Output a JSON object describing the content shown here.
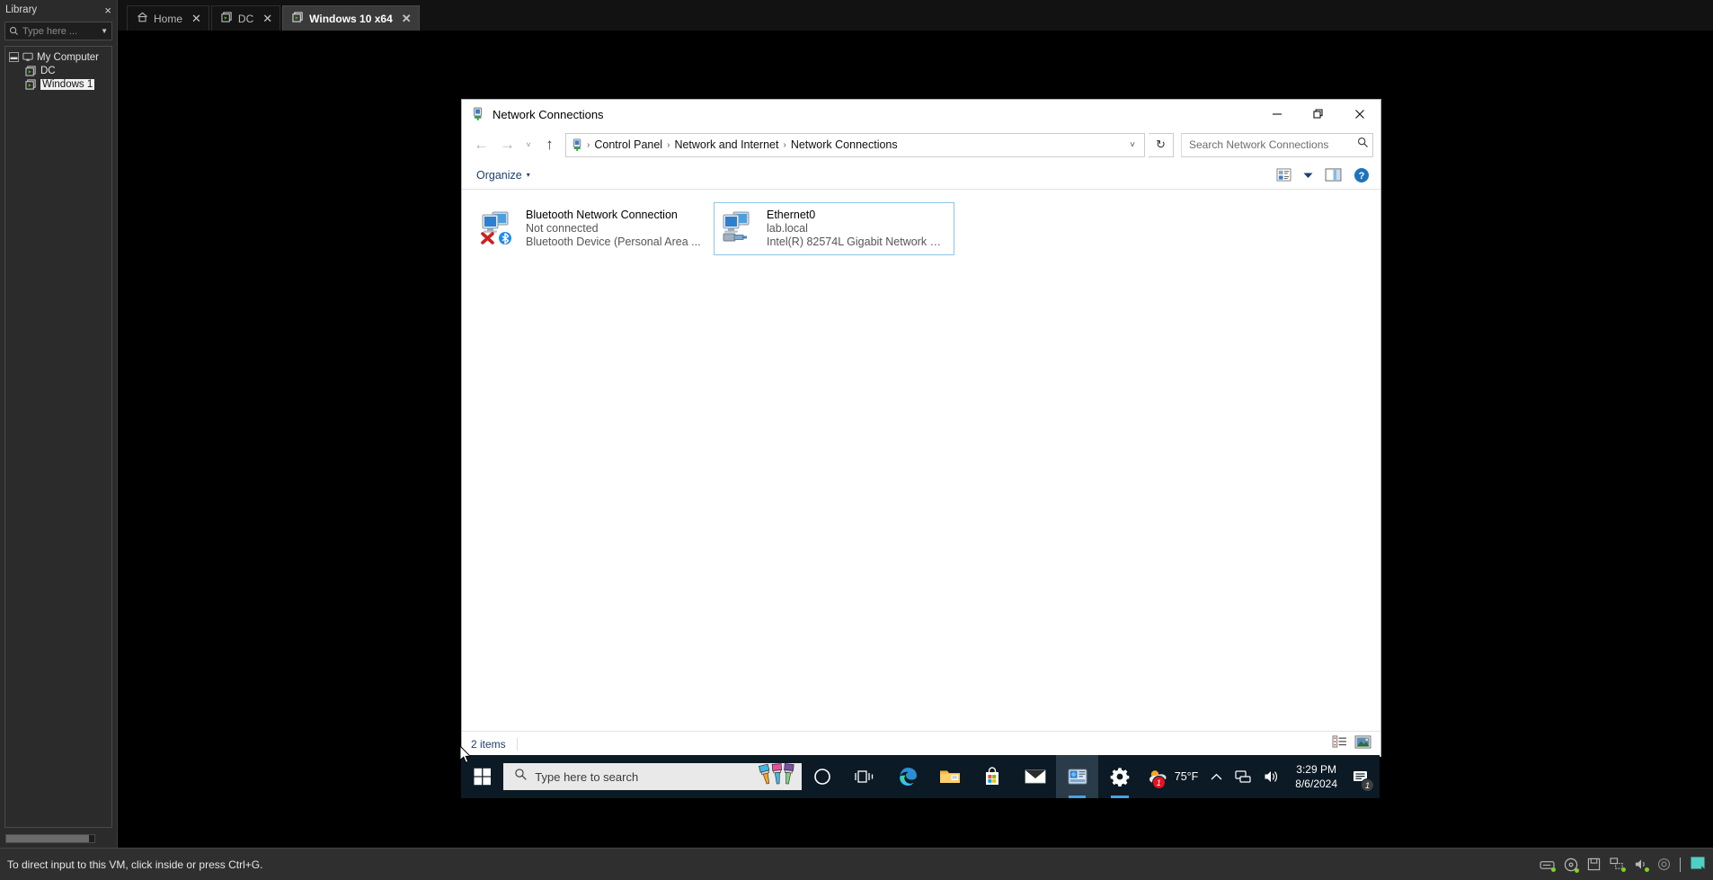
{
  "vmware": {
    "library": {
      "title": "Library",
      "close_label": "×",
      "search_placeholder": "Type here ...",
      "tree": [
        {
          "label": "My Computer",
          "icon": "computer-icon",
          "level": 0,
          "expanded": true,
          "selected": false
        },
        {
          "label": "DC",
          "icon": "vm-icon",
          "level": 1,
          "expanded": false,
          "selected": false
        },
        {
          "label": "Windows 1",
          "icon": "vm-icon",
          "level": 1,
          "expanded": false,
          "selected": true
        }
      ]
    },
    "tabs": [
      {
        "label": "Home",
        "icon": "home-icon",
        "active": false,
        "closable": true
      },
      {
        "label": "DC",
        "icon": "vm-icon",
        "active": false,
        "closable": true
      },
      {
        "label": "Windows 10 x64",
        "icon": "vm-icon",
        "active": true,
        "closable": true
      }
    ],
    "status_text": "To direct input to this VM, click inside or press Ctrl+G.",
    "device_icons": [
      "hard-disk-icon",
      "cd-dvd-icon",
      "floppy-icon",
      "network-adapter-icon",
      "sound-card-icon",
      "usb-icon"
    ]
  },
  "explorer": {
    "title": "Network Connections",
    "title_icon": "network-connections-icon",
    "window_buttons": {
      "minimize": "─",
      "restore": "❐",
      "close": "✕"
    },
    "nav": {
      "back": "←",
      "forward": "→",
      "recent": "˅",
      "up": "↑",
      "refresh": "↻",
      "dropdown": "˅"
    },
    "breadcrumb": [
      "Control Panel",
      "Network and Internet",
      "Network Connections"
    ],
    "breadcrumb_separator": "›",
    "search": {
      "placeholder": "Search Network Connections",
      "value": "",
      "icon": "search-icon"
    },
    "toolbar": {
      "organize_label": "Organize",
      "organize_caret": "▾",
      "view_options_icon": "view-options-icon",
      "view_caret": "▾",
      "preview_pane_icon": "preview-pane-icon",
      "help_icon": "help-icon"
    },
    "connections": [
      {
        "name": "Bluetooth Network Connection",
        "status": "Not connected",
        "device": "Bluetooth Device (Personal Area ...",
        "icon": "network-adapter-icon",
        "overlay": "bluetooth-disconnected-icon",
        "selected": false
      },
      {
        "name": "Ethernet0",
        "status": "lab.local",
        "device": "Intel(R) 82574L Gigabit Network C...",
        "icon": "network-adapter-icon",
        "overlay": "ethernet-cable-icon",
        "selected": true
      }
    ],
    "status": {
      "item_count": "2 items",
      "details_view_icon": "details-view-icon",
      "large-icons_view_icon": "large-icons-view-icon"
    }
  },
  "taskbar": {
    "start_icon": "windows-start-icon",
    "search": {
      "placeholder": "Type here to search",
      "icon": "search-icon",
      "decoration_icon": "paintbrushes-icon"
    },
    "apps": [
      {
        "name": "cortana-icon",
        "active": false,
        "open": false
      },
      {
        "name": "task-view-icon",
        "active": false,
        "open": false
      },
      {
        "name": "microsoft-edge-icon",
        "active": false,
        "open": false
      },
      {
        "name": "file-explorer-icon",
        "active": false,
        "open": false
      },
      {
        "name": "microsoft-store-icon",
        "active": false,
        "open": false
      },
      {
        "name": "mail-icon",
        "active": false,
        "open": false
      },
      {
        "name": "network-connections-icon",
        "active": true,
        "open": true
      },
      {
        "name": "settings-icon",
        "active": false,
        "open": true
      }
    ],
    "tray": {
      "weather_temp": "75°F",
      "weather_icon": "weather-partly-cloudy-icon",
      "weather_badge": "1",
      "show_hidden_icon": "chevron-up-icon",
      "network_icon": "network-icon",
      "volume_icon": "volume-icon",
      "time": "3:29 PM",
      "date": "8/6/2024",
      "notification_icon": "action-center-icon",
      "notification_badge": "1"
    }
  },
  "colors": {
    "accent_blue": "#4aa3df",
    "taskbar_bg": "#0b1a25",
    "selection_border": "#8ec4e8",
    "link_blue": "#1d3f6e",
    "vm_green": "#4caf1a"
  }
}
